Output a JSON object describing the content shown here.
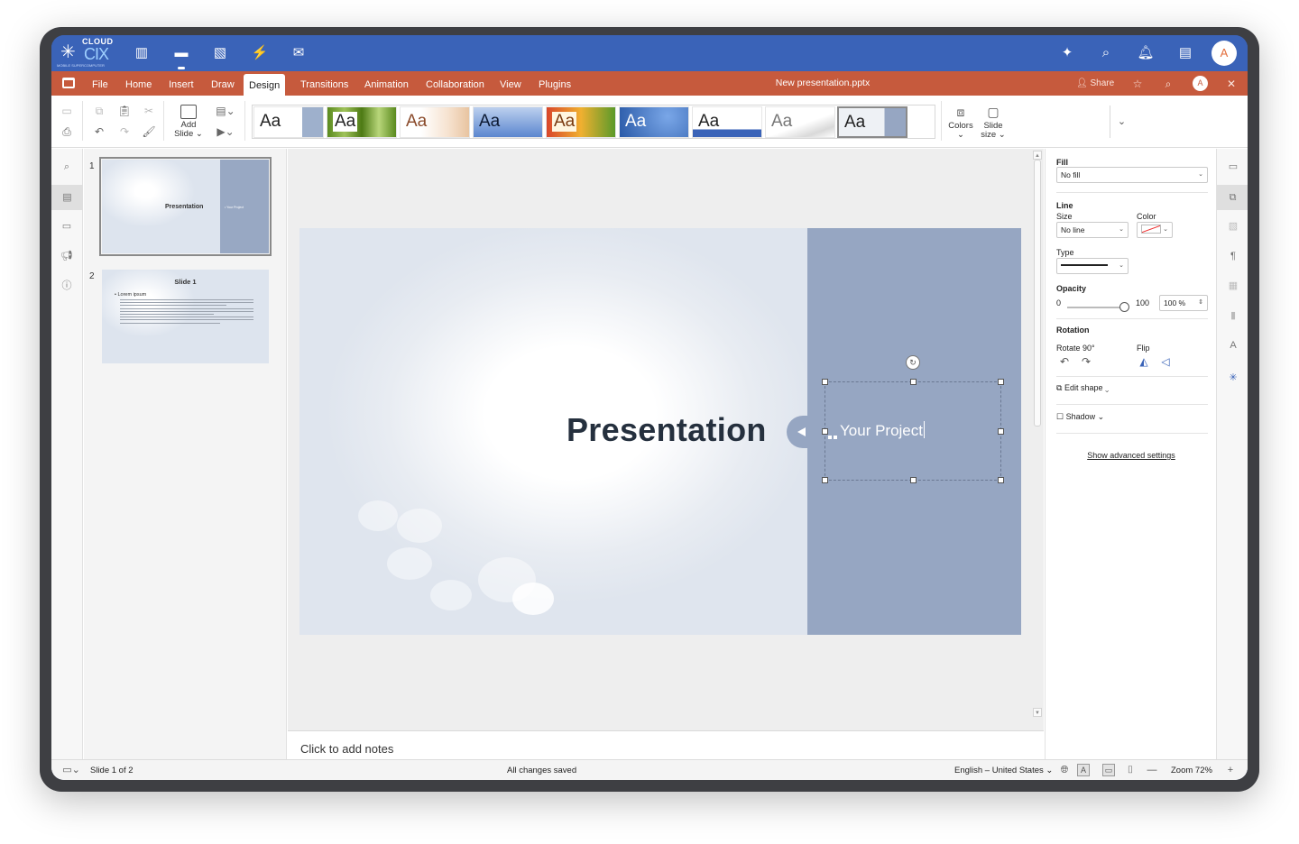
{
  "os_bar": {
    "logo_top": "CLOUD",
    "logo_main": "CIX",
    "logo_sub": "MOBILE SUPERCOMPUTER",
    "avatar": "A",
    "icons": [
      "apps-grid-icon",
      "folder-icon",
      "image-icon",
      "bolt-icon",
      "mail-icon",
      "sparkle-icon",
      "search-icon",
      "bell-icon",
      "contacts-icon"
    ]
  },
  "menu": {
    "tabs": [
      "File",
      "Home",
      "Insert",
      "Draw",
      "Design",
      "Transitions",
      "Animation",
      "Collaboration",
      "View",
      "Plugins"
    ],
    "active_tab": "Design",
    "document_title": "New presentation.pptx",
    "share_label": "Share",
    "avatar": "A"
  },
  "toolbar": {
    "add_slide_label": "Add",
    "add_slide_label2": "Slide",
    "theme_sample": "Aa",
    "colors_label": "Colors",
    "slide_size_label": "Slide",
    "slide_size_label2": "size"
  },
  "thumbnails": [
    {
      "number": "1",
      "title": "Presentation",
      "subtitle": "• Your Project"
    },
    {
      "number": "2",
      "title": "Slide 1",
      "bullet": "• Lorem ipsum"
    }
  ],
  "slide": {
    "title": "Presentation",
    "subtitle": "Your Project"
  },
  "notes_placeholder": "Click to add notes",
  "panel": {
    "fill_label": "Fill",
    "fill_value": "No fill",
    "line_label": "Line",
    "size_label": "Size",
    "size_value": "No line",
    "color_label": "Color",
    "type_label": "Type",
    "opacity_label": "Opacity",
    "opacity_min": "0",
    "opacity_max": "100",
    "opacity_value": "100 %",
    "opacity_level": 1.0,
    "rotation_label": "Rotation",
    "rotate_label": "Rotate 90°",
    "flip_label": "Flip",
    "edit_shape_label": "Edit shape",
    "shadow_label": "Shadow",
    "advanced_label": "Show advanced settings"
  },
  "status": {
    "slide_indicator": "Slide 1 of 2",
    "save_state": "All changes saved",
    "language": "English – United States",
    "zoom": "Zoom 72%"
  },
  "colors": {
    "os_bar": "#3a63b8",
    "menu_bar": "#c65a3d",
    "slide_band": "#96a6c2"
  }
}
